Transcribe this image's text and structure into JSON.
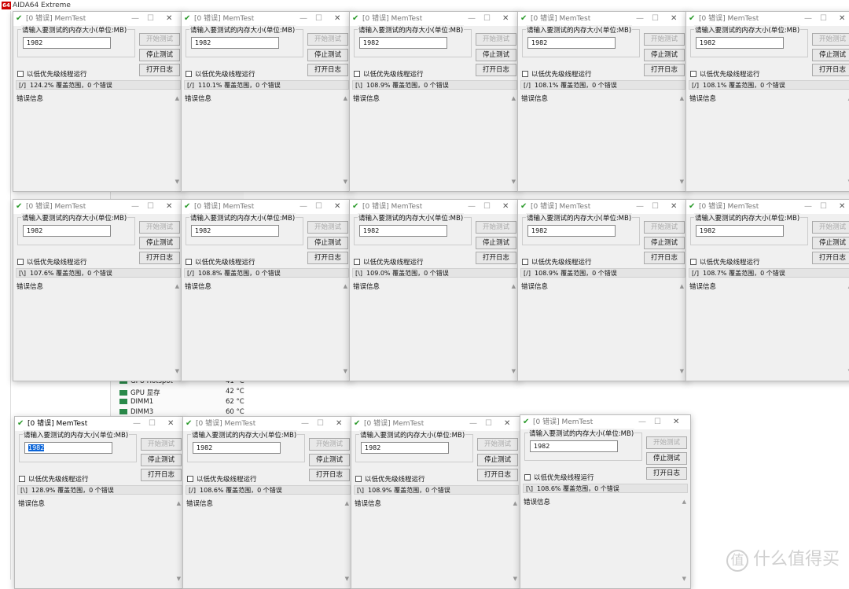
{
  "background_app": {
    "title": "AIDA64 Extreme",
    "logo": "64",
    "sensors": [
      {
        "name": "GPU Hotspot",
        "value": "41 °C"
      },
      {
        "name": "GPU 显存",
        "value": "42 °C"
      },
      {
        "name": "DIMM1",
        "value": "62 °C"
      },
      {
        "name": "DIMM3",
        "value": "60 °C"
      }
    ]
  },
  "window_common": {
    "title": "[0 错误] MemTest",
    "size_label": "请输入要测试的内存大小(单位:MB)",
    "size_value": "1982",
    "start_button": "开始测试",
    "stop_button": "停止测试",
    "log_button": "打开日志",
    "low_priority_label": "以低优先级线程运行",
    "error_info_label": "错误信息",
    "status_suffix": "覆盖范围，0 个错误"
  },
  "windows": [
    {
      "spinner": "[/]",
      "coverage": "124.2%"
    },
    {
      "spinner": "[/]",
      "coverage": "110.1%"
    },
    {
      "spinner": "[\\]",
      "coverage": "108.9%"
    },
    {
      "spinner": "[/]",
      "coverage": "108.1%"
    },
    {
      "spinner": "[/]",
      "coverage": "108.1%"
    },
    {
      "spinner": "[\\]",
      "coverage": "107.6%"
    },
    {
      "spinner": "[/]",
      "coverage": "108.8%"
    },
    {
      "spinner": "[\\]",
      "coverage": "109.0%"
    },
    {
      "spinner": "[/]",
      "coverage": "108.9%"
    },
    {
      "spinner": "[/]",
      "coverage": "108.7%"
    },
    {
      "spinner": "[\\]",
      "coverage": "128.9%",
      "active": true
    },
    {
      "spinner": "[/]",
      "coverage": "108.6%"
    },
    {
      "spinner": "[\\]",
      "coverage": "108.9%"
    },
    {
      "spinner": "[\\]",
      "coverage": "108.6%"
    }
  ],
  "watermark": {
    "badge": "值",
    "text": "什么值得买"
  },
  "icons": {
    "window": "memtest-check-icon"
  }
}
